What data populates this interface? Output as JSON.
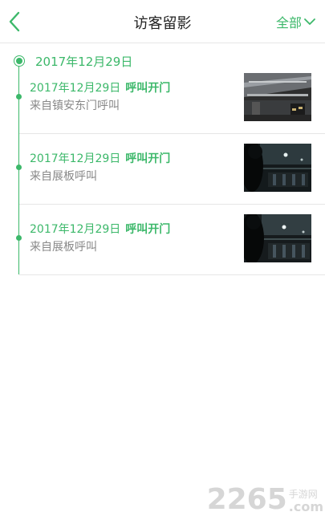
{
  "header": {
    "title": "访客留影",
    "filter_label": "全部"
  },
  "timeline": {
    "date": "2017年12月29日",
    "records": [
      {
        "date": "2017年12月29日",
        "action": "呼叫开门",
        "source": "来自镇安东门呼叫"
      },
      {
        "date": "2017年12月29日",
        "action": "呼叫开门",
        "source": "来自展板呼叫"
      },
      {
        "date": "2017年12月29日",
        "action": "呼叫开门",
        "source": "来自展板呼叫"
      }
    ]
  },
  "watermark": {
    "number": "2265",
    "cn": "手游网",
    "domain": ".com"
  },
  "colors": {
    "accent": "#3cb86a",
    "title_text": "#222222",
    "sub_text": "#888888",
    "divider": "#e6e6e6"
  }
}
